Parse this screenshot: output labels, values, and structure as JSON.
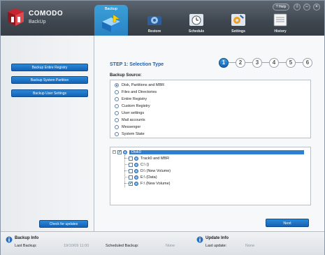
{
  "app": {
    "brand": "COMODO",
    "product": "BackUp",
    "help_label": "Help"
  },
  "tabs": [
    {
      "label": "Backup"
    },
    {
      "label": "Restore"
    },
    {
      "label": "Schedule"
    },
    {
      "label": "Settings"
    },
    {
      "label": "History"
    }
  ],
  "sidebar": {
    "items": [
      {
        "label": "Backup Entire Registry"
      },
      {
        "label": "Backup System Partition"
      },
      {
        "label": "Backup User Settings"
      }
    ],
    "check_updates": "Check for updates"
  },
  "wizard": {
    "step_title": "STEP 1: Selection Type",
    "steps": [
      "1",
      "2",
      "3",
      "4",
      "5",
      "6"
    ],
    "active_step": "1",
    "source_label": "Backup Source:"
  },
  "sources": [
    {
      "label": "Disk, Partitions and MBR",
      "selected": true
    },
    {
      "label": "Files and Directories",
      "selected": false
    },
    {
      "label": "Entire Registry",
      "selected": false
    },
    {
      "label": "Custom Registry",
      "selected": false
    },
    {
      "label": "User settings",
      "selected": false
    },
    {
      "label": "Mail accounts",
      "selected": false
    },
    {
      "label": "Messenger",
      "selected": false
    },
    {
      "label": "System State",
      "selected": false
    }
  ],
  "tree": {
    "root": "Disk0",
    "children": [
      {
        "label": "Track0 and MBR",
        "checked": false
      },
      {
        "label": "C:\\ ()",
        "checked": false
      },
      {
        "label": "D:\\ (New Volume)",
        "checked": false
      },
      {
        "label": "E:\\ (Data)",
        "checked": false
      },
      {
        "label": "F:\\ (New Volume)",
        "checked": true
      }
    ]
  },
  "buttons": {
    "next": "Next"
  },
  "footer": {
    "backup_info_title": "Backup Info",
    "last_backup_label": "Last Backup:",
    "last_backup_value": "19/10/09 11:00",
    "scheduled_label": "Scheduled Backup:",
    "scheduled_value": "None",
    "update_info_title": "Update Info",
    "last_update_label": "Last update:",
    "last_update_value": "None"
  },
  "colors": {
    "accent": "#1f5fb0",
    "header": "#3e464f",
    "tab_active": "#2a82c2"
  }
}
